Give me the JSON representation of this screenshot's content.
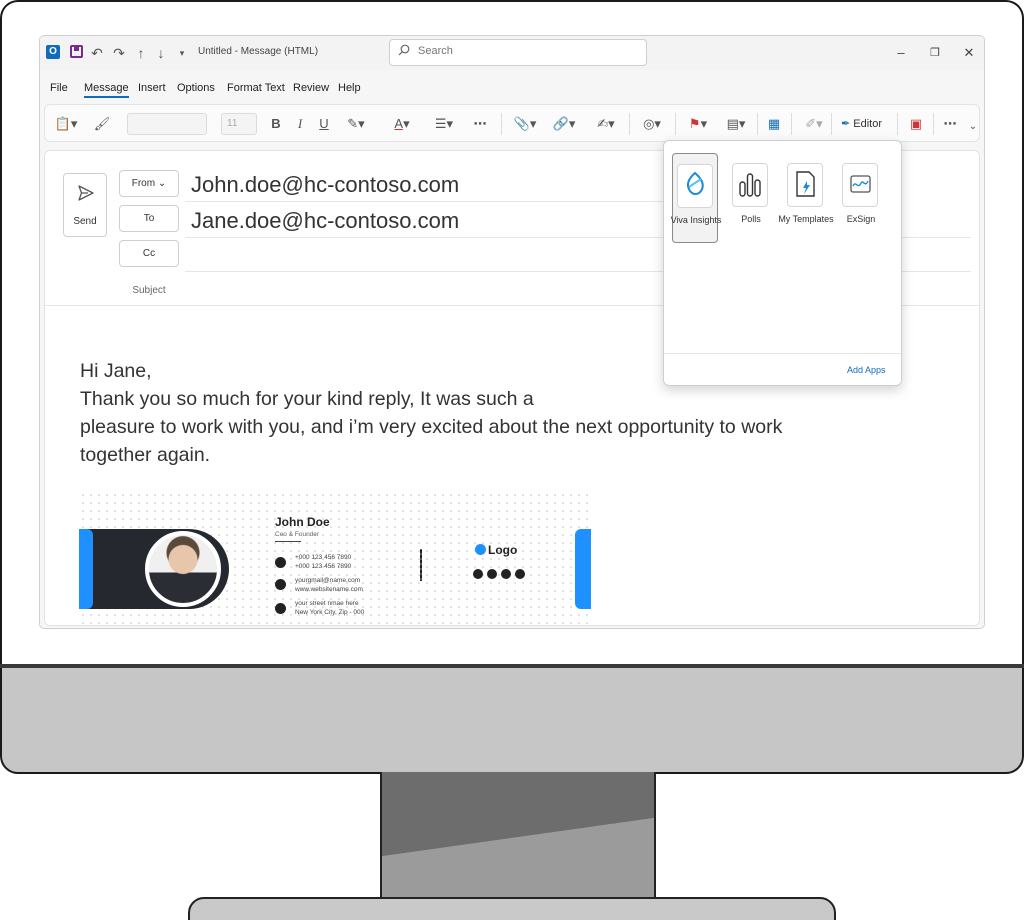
{
  "window": {
    "title": "Untitled  -  Message (HTML)",
    "search_placeholder": "Search"
  },
  "menu": [
    "File",
    "Message",
    "Insert",
    "Options",
    "Format Text",
    "Review",
    "Help"
  ],
  "ribbon": {
    "font_size": "11",
    "editor_label": "Editor"
  },
  "compose": {
    "send_label": "Send",
    "from_label": "From",
    "to_label": "To",
    "cc_label": "Cc",
    "subject_label": "Subject",
    "from_value": "John.doe@hc-contoso.com",
    "to_value": "Jane.doe@hc-contoso.com",
    "body_lines": [
      "Hi Jane,",
      "Thank you so much for your kind reply, It was such a",
      "pleasure to work with you, and i’m very excited about the next opportunity to work",
      "together again."
    ]
  },
  "signature": {
    "name": "John Doe",
    "role": "Ceo & Founder",
    "phone1": "+000 123 456 7890",
    "phone2": "+000 123 456 7890",
    "email": "yourgmail@name.com",
    "website": "www.websitename.com",
    "street": "your street nmae here",
    "city": "New York City, Zip - 000",
    "logo": "Logo"
  },
  "apps_flyout": {
    "apps": [
      {
        "label": "Viva Insights",
        "icon": "viva-insights-icon"
      },
      {
        "label": "Polls",
        "icon": "polls-icon"
      },
      {
        "label": "My Templates",
        "icon": "my-templates-icon"
      },
      {
        "label": "ExSign",
        "icon": "exsign-icon"
      }
    ],
    "add_apps": "Add Apps"
  },
  "colors": {
    "accent": "#0f6cbd",
    "signature_blue": "#1e90ff",
    "signature_dark": "#262830",
    "flag_red": "#d13438"
  }
}
